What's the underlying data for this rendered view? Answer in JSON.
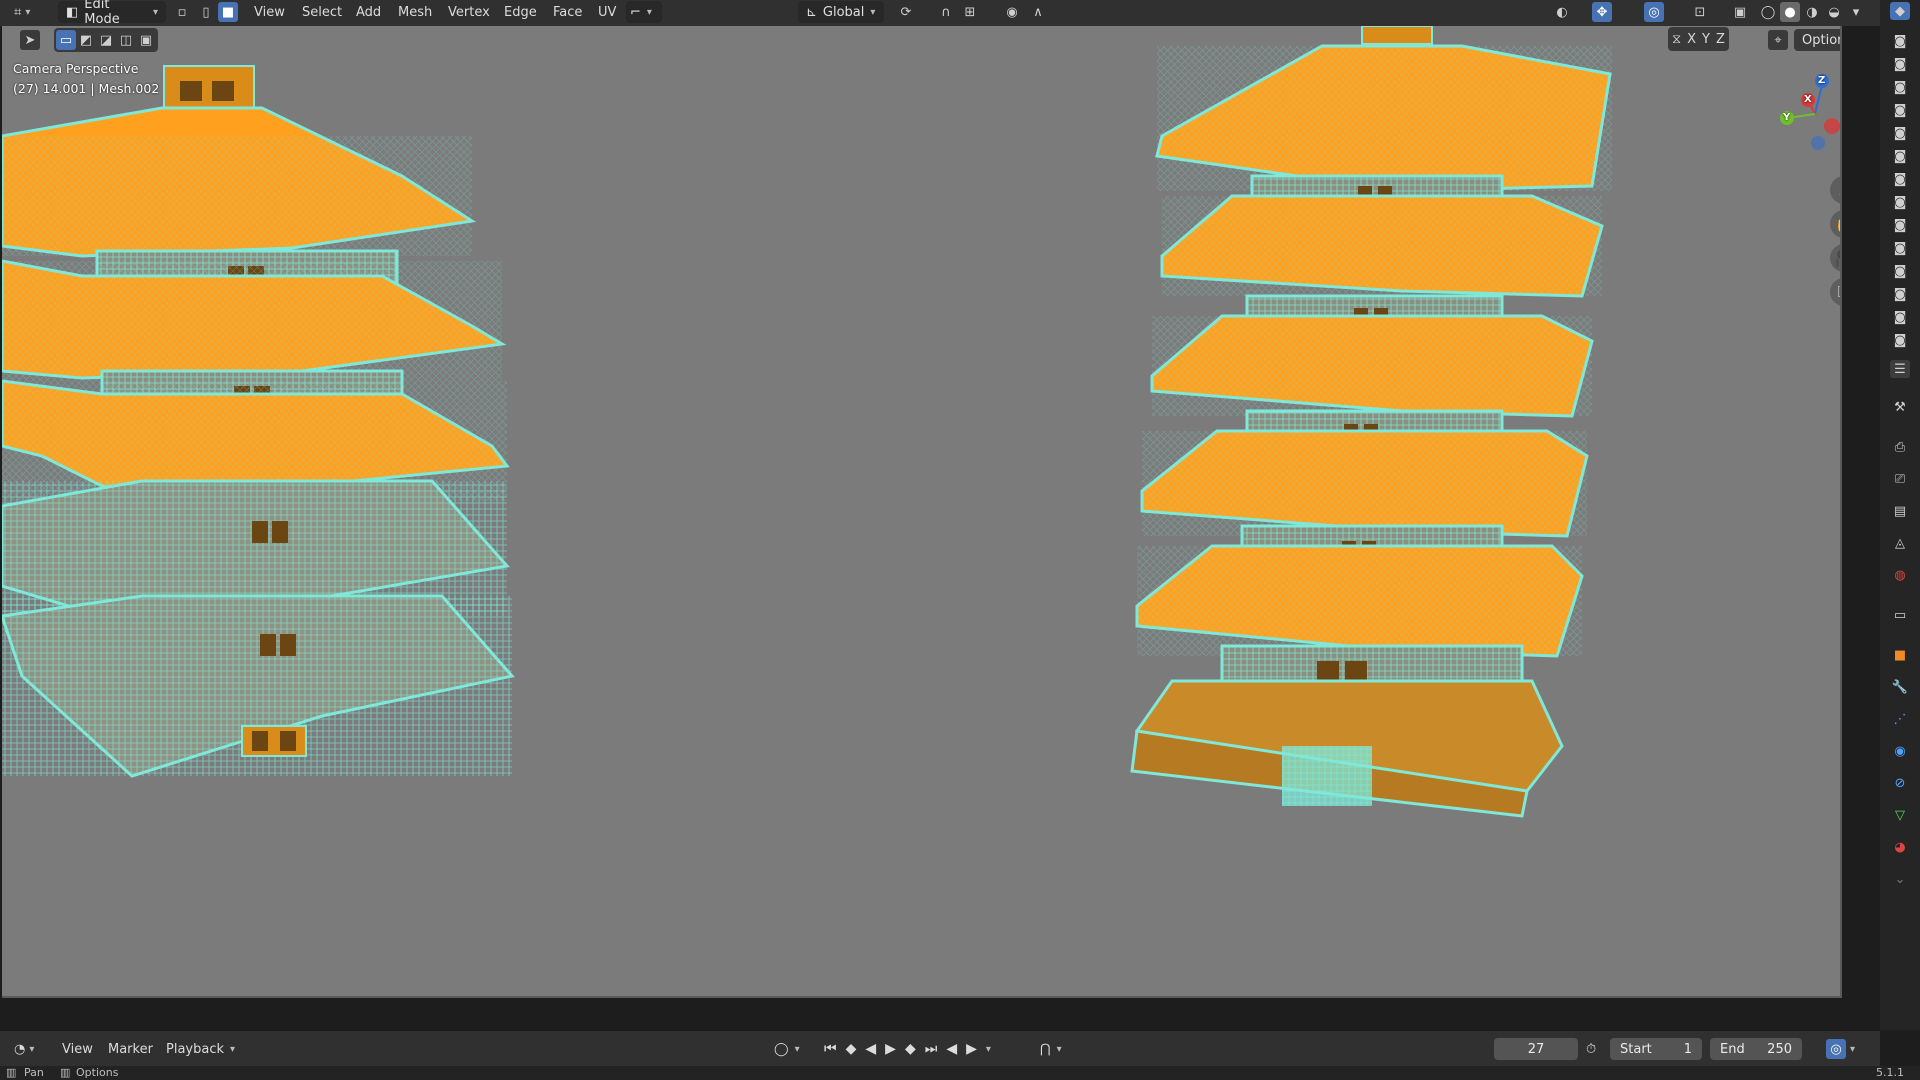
{
  "header": {
    "mode": "Edit Mode",
    "menus": [
      "View",
      "Select",
      "Add",
      "Mesh",
      "Vertex",
      "Edge",
      "Face",
      "UV"
    ],
    "transform_orientation": "Global"
  },
  "viewport": {
    "camera_label": "Camera Perspective",
    "object_info": "(27) 14.001 | Mesh.002",
    "options_label": "Options",
    "axis_x": "X",
    "axis_y": "Y",
    "axis_z": "Z",
    "gizmo_x": "X",
    "gizmo_y": "Y",
    "gizmo_z": "Z",
    "colors": {
      "selected_face": "#ffa01e",
      "wire": "#7fe8d8",
      "background": "#7b7b7b"
    }
  },
  "timeline": {
    "menus": [
      "View",
      "Marker",
      "Playback"
    ],
    "current_frame": "27",
    "start_label": "Start",
    "start_value": "1",
    "end_label": "End",
    "end_value": "250"
  },
  "status": {
    "left": "Pan",
    "right": "Options",
    "version": "5.1.1"
  }
}
